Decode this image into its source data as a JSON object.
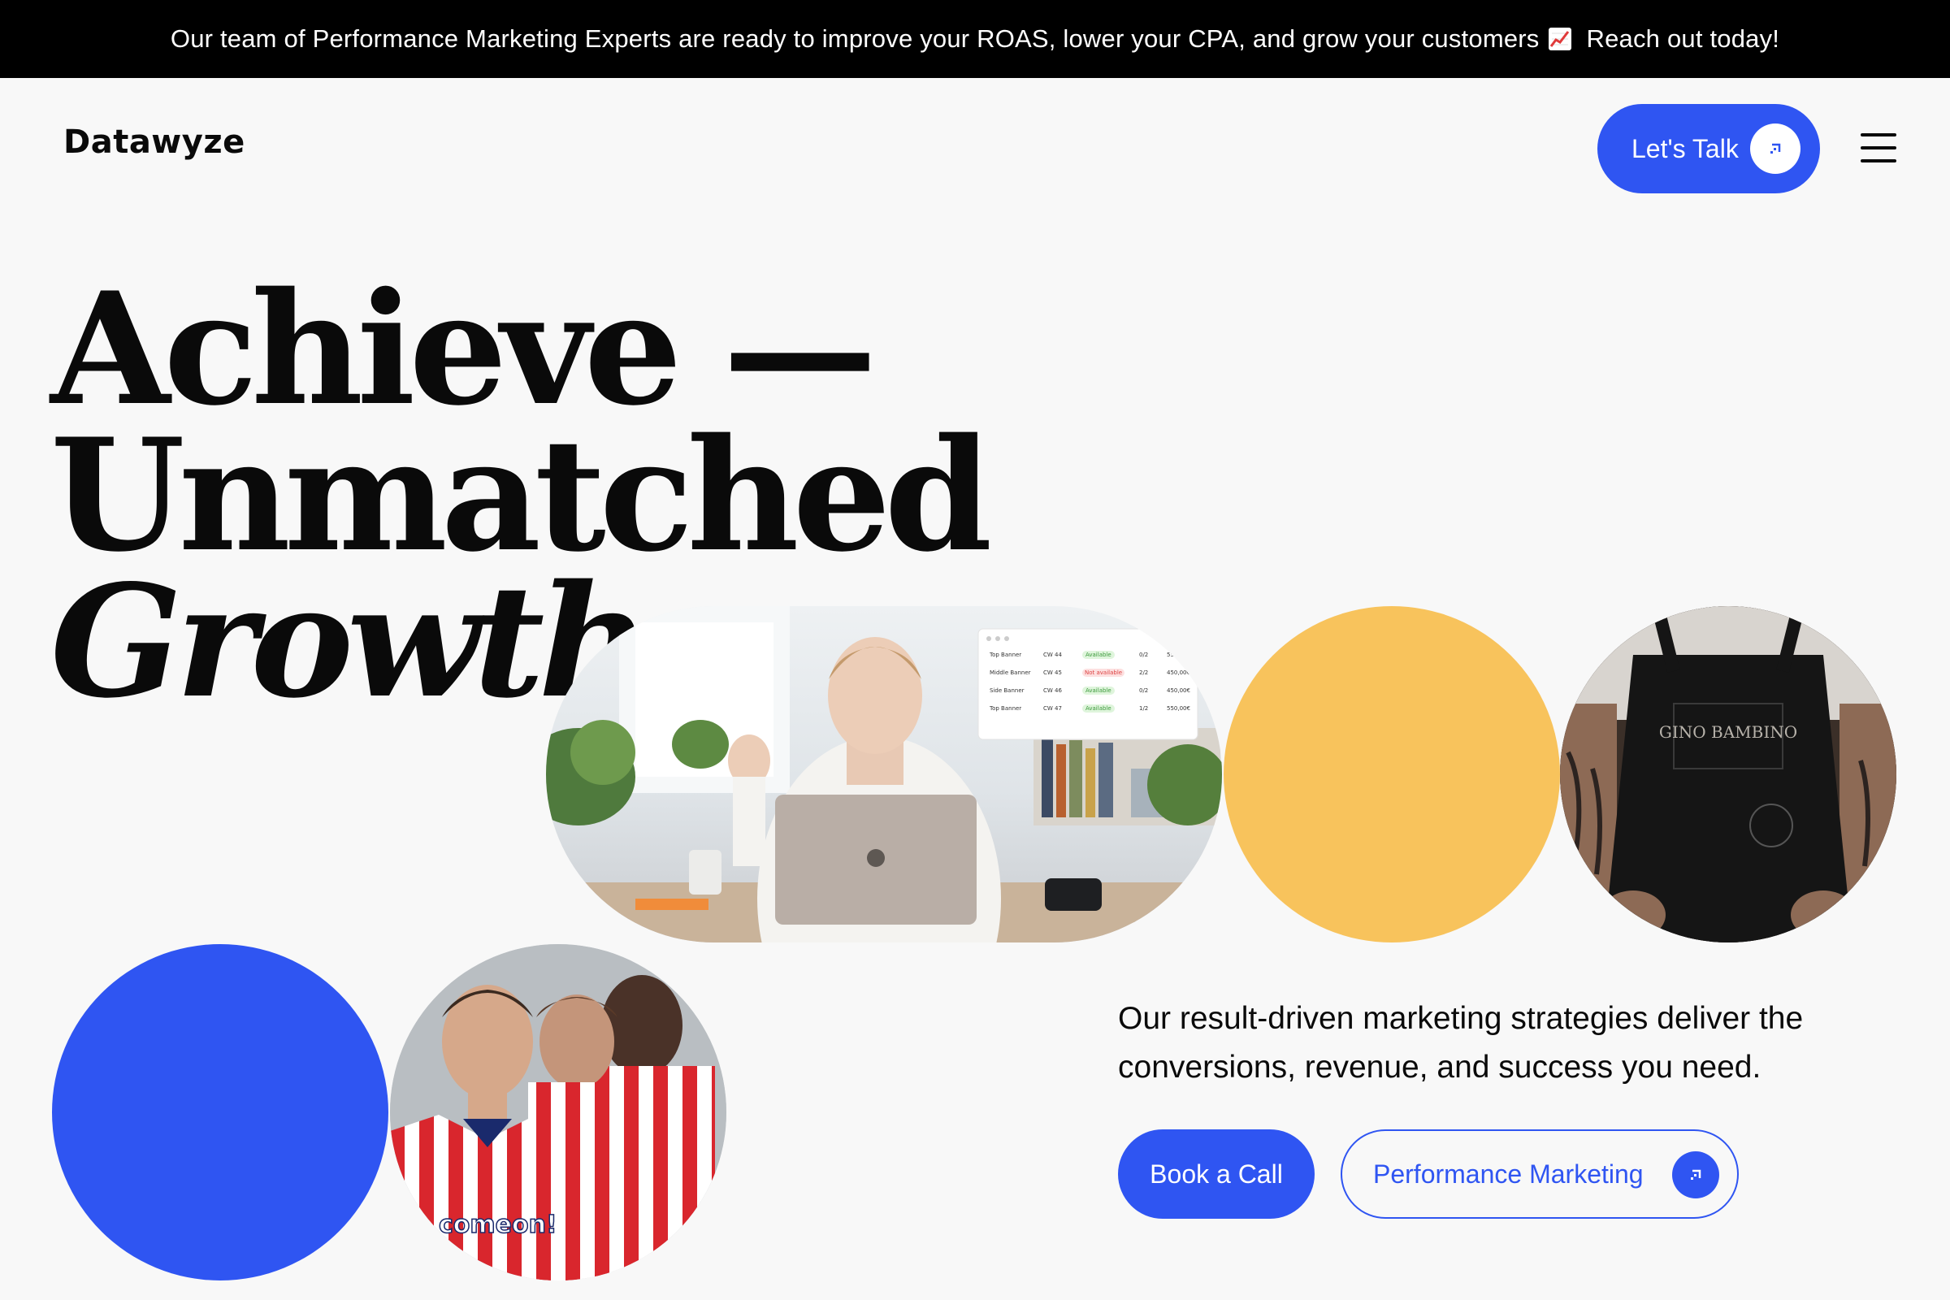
{
  "announcement": {
    "text": "Our team of Performance Marketing Experts are ready to improve your ROAS, lower your CPA, and grow your customers",
    "emoji_icon": "chart-increasing-icon",
    "cta": "Reach out today!"
  },
  "header": {
    "logo": "Datawyze",
    "talk_button": "Let's Talk",
    "menu_icon": "hamburger-menu-icon"
  },
  "hero": {
    "line1": "Achieve —",
    "line2": "Unmatched",
    "line3": "Growth"
  },
  "tagline": "Our result-driven marketing strategies deliver the conversions, revenue, and success you need.",
  "buttons": {
    "book_call": "Book a Call",
    "performance": "Performance Marketing"
  },
  "images": {
    "woman_laptop": "woman-working-on-laptop-photo",
    "apron": "chef-apron-photo",
    "apron_text": "GINO BAMBINO",
    "football": "football-players-photo",
    "shirt_sponsor": "comeon!"
  },
  "dashboard_card": {
    "rows": [
      {
        "name": "Top Banner",
        "week": "CW 44",
        "status": "Available",
        "count": "0/2",
        "price": "55.."
      },
      {
        "name": "Middle Banner",
        "week": "CW 45",
        "status": "Not available",
        "count": "2/2",
        "price": "450,00€"
      },
      {
        "name": "Side Banner",
        "week": "CW 46",
        "status": "Available",
        "count": "0/2",
        "price": "450,00€"
      },
      {
        "name": "Top Banner",
        "week": "CW 47",
        "status": "Available",
        "count": "1/2",
        "price": "550,00€"
      }
    ]
  },
  "colors": {
    "accent": "#2f55f2",
    "yellow": "#f8c35c",
    "background": "#f8f8f8",
    "announcement_bg": "#000000"
  }
}
